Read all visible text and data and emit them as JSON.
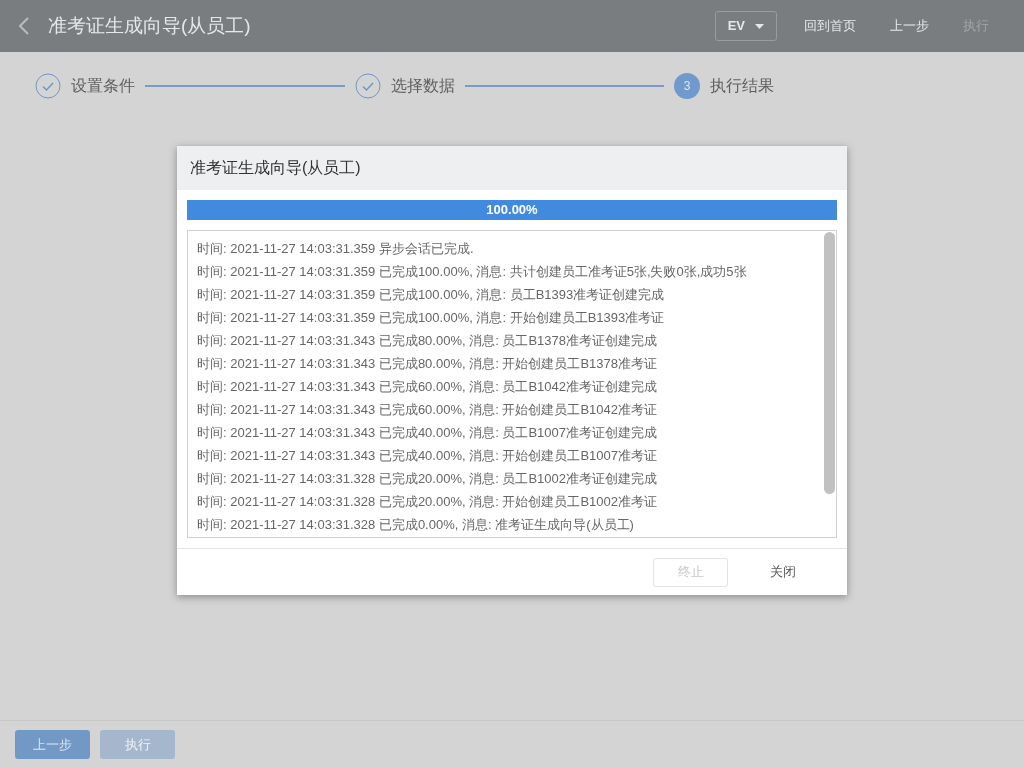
{
  "header": {
    "title": "准考证生成向导(从员工)",
    "language": "EV",
    "actions": [
      {
        "label": "回到首页",
        "disabled": false
      },
      {
        "label": "上一步",
        "disabled": false
      },
      {
        "label": "执行",
        "disabled": true
      }
    ]
  },
  "steps": [
    {
      "kind": "done",
      "label": "设置条件"
    },
    {
      "kind": "done",
      "label": "选择数据"
    },
    {
      "kind": "current",
      "label": "执行结果",
      "number": "3"
    }
  ],
  "dialog": {
    "title": "准考证生成向导(从员工)",
    "progress": {
      "level": 1,
      "label": "100.00%"
    },
    "log": [
      "时间: 2021-11-27 14:03:31.359 异步会话已完成.",
      "时间: 2021-11-27 14:03:31.359 已完成100.00%, 消息: 共计创建员工准考证5张,失败0张,成功5张",
      "时间: 2021-11-27 14:03:31.359 已完成100.00%, 消息: 员工B1393准考证创建完成",
      "时间: 2021-11-27 14:03:31.359 已完成100.00%, 消息: 开始创建员工B1393准考证",
      "时间: 2021-11-27 14:03:31.343 已完成80.00%, 消息: 员工B1378准考证创建完成",
      "时间: 2021-11-27 14:03:31.343 已完成80.00%, 消息: 开始创建员工B1378准考证",
      "时间: 2021-11-27 14:03:31.343 已完成60.00%, 消息: 员工B1042准考证创建完成",
      "时间: 2021-11-27 14:03:31.343 已完成60.00%, 消息: 开始创建员工B1042准考证",
      "时间: 2021-11-27 14:03:31.343 已完成40.00%, 消息: 员工B1007准考证创建完成",
      "时间: 2021-11-27 14:03:31.343 已完成40.00%, 消息: 开始创建员工B1007准考证",
      "时间: 2021-11-27 14:03:31.328 已完成20.00%, 消息: 员工B1002准考证创建完成",
      "时间: 2021-11-27 14:03:31.328 已完成20.00%, 消息: 开始创建员工B1002准考证",
      "时间: 2021-11-27 14:03:31.328 已完成0.00%, 消息: 准考证生成向导(从员工)"
    ],
    "buttons": [
      {
        "label": "终止",
        "kind": "outline",
        "disabled": true
      },
      {
        "label": "关闭",
        "kind": "text",
        "disabled": false
      }
    ]
  },
  "footer": {
    "buttons": [
      {
        "label": "上一步",
        "disabled": false
      },
      {
        "label": "执行",
        "disabled": true
      }
    ]
  }
}
